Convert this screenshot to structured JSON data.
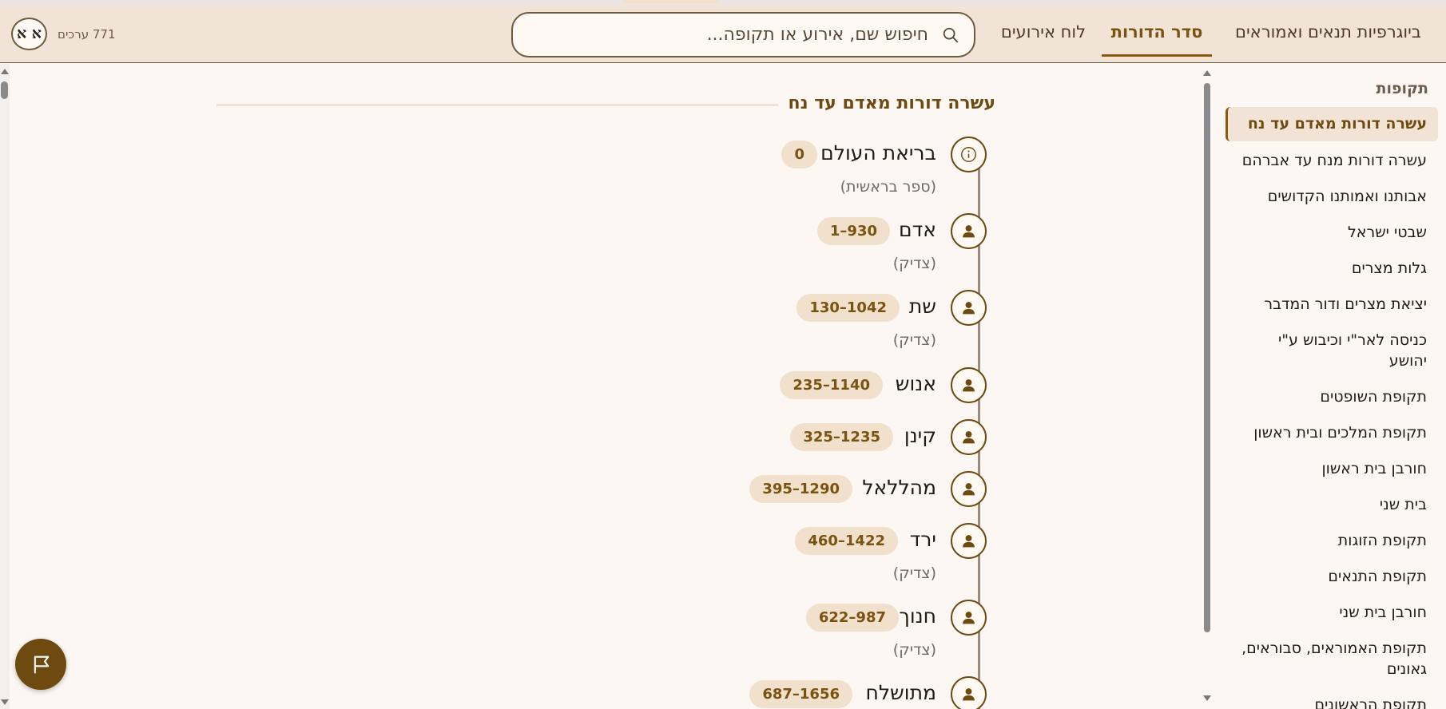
{
  "header": {
    "tabs": [
      {
        "label": "ביוגרפיות תנאים ואמוראים"
      },
      {
        "label": "סדר הדורות"
      },
      {
        "label": "לוח אירועים"
      }
    ],
    "search_placeholder": "חיפוש שם, אירוע או תקופה...",
    "entries_count": "771 ערכים",
    "font_toggle": "א א"
  },
  "sidebar": {
    "heading": "תקופות",
    "items": [
      "עשרה דורות מאדם עד נח",
      "עשרה דורות מנח עד אברהם",
      "אבותנו ואמותנו הקדושים",
      "שבטי ישראל",
      "גלות מצרים",
      "יציאת מצרים ודור המדבר",
      "כניסה לאר\"י וכיבוש ע\"י יהושע",
      "תקופת השופטים",
      "תקופת המלכים ובית ראשון",
      "חורבן בית ראשון",
      "בית שני",
      "תקופת הזוגות",
      "תקופת התנאים",
      "חורבן בית שני",
      "תקופת האמוראים, סבוראים, גאונים",
      "תקופת הראשונים"
    ]
  },
  "main": {
    "section_title": "עשרה דורות מאדם עד נח",
    "items": [
      {
        "name": "בריאת העולם",
        "years": "0",
        "note": "(ספר בראשית)",
        "icon": "info-icon"
      },
      {
        "name": "אדם",
        "years": "1–930",
        "note": "(צדיק)",
        "icon": "person-icon"
      },
      {
        "name": "שת",
        "years": "130–1042",
        "note": "(צדיק)",
        "icon": "person-icon"
      },
      {
        "name": "אנוש",
        "years": "235–1140",
        "note": "",
        "icon": "person-icon"
      },
      {
        "name": "קינן",
        "years": "325–1235",
        "note": "",
        "icon": "person-icon"
      },
      {
        "name": "מהללאל",
        "years": "395–1290",
        "note": "",
        "icon": "person-icon"
      },
      {
        "name": "ירד",
        "years": "460–1422",
        "note": "(צדיק)",
        "icon": "person-icon"
      },
      {
        "name": "חנוך",
        "years": "622–987",
        "note": "(צדיק)",
        "icon": "person-icon"
      },
      {
        "name": "מתושלח",
        "years": "687–1656",
        "note": "",
        "icon": "person-icon"
      }
    ]
  },
  "colors": {
    "accent": "#7a5310",
    "header_bg": "#f1e4d6",
    "page_bg": "#fdf7f3",
    "badge_bg": "#f0e0cc"
  }
}
